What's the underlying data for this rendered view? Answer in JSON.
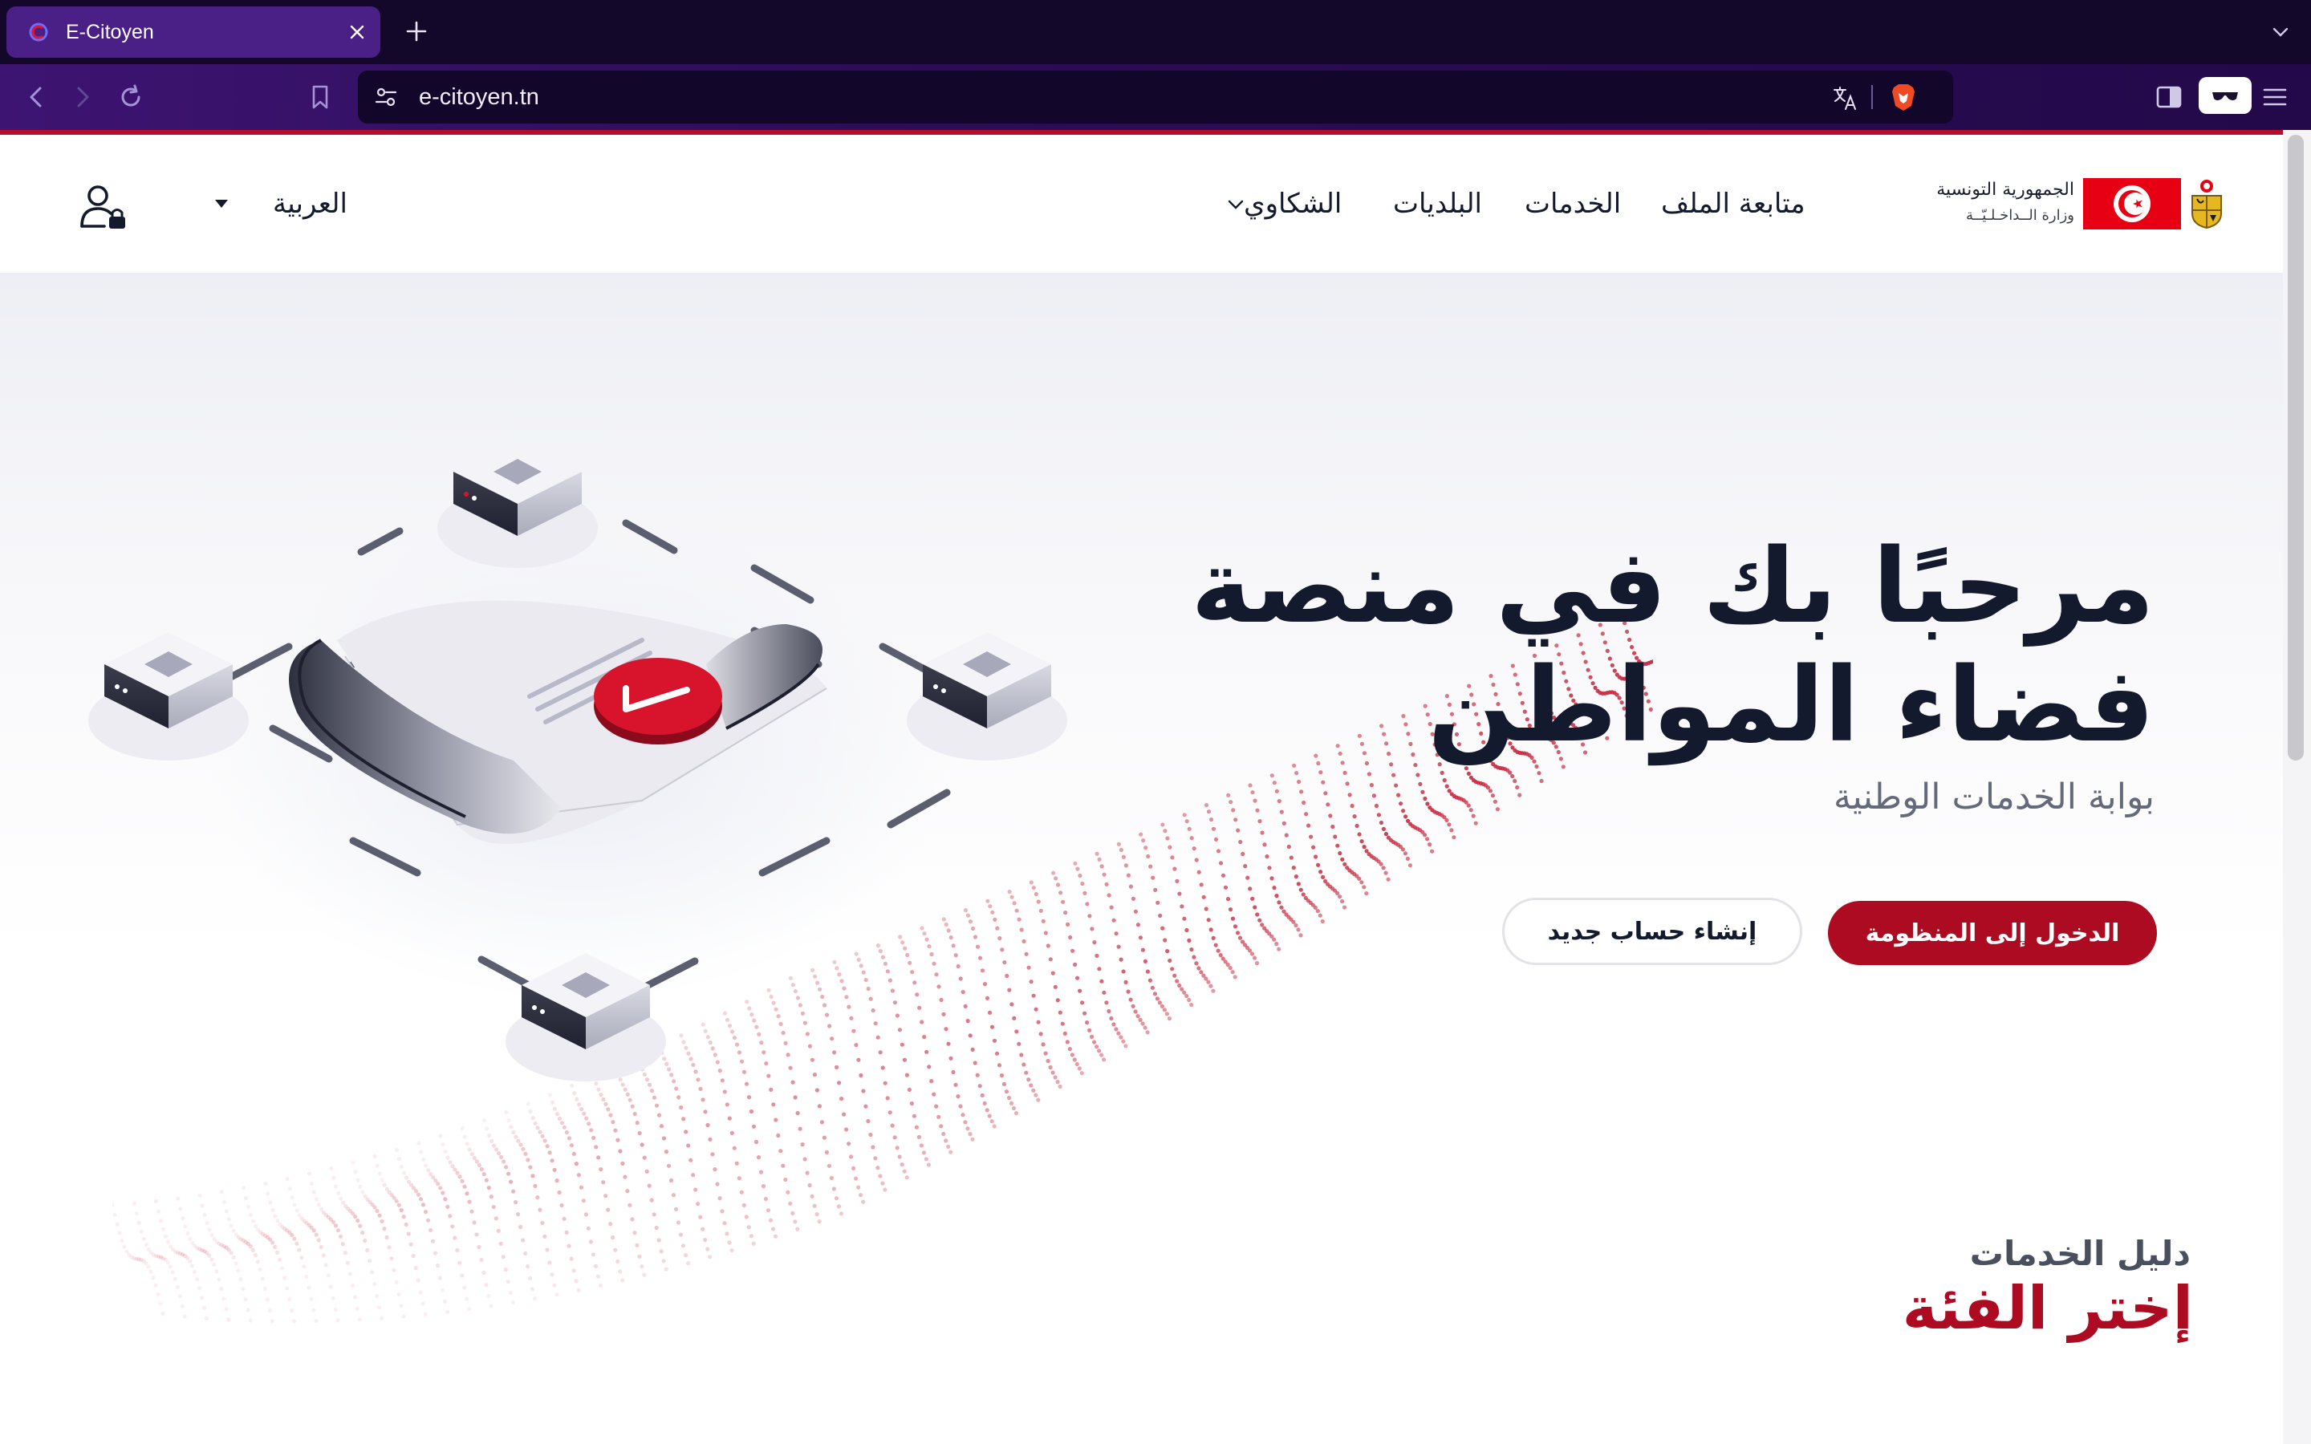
{
  "browser": {
    "tab": {
      "title": "E-Citoyen"
    },
    "address_bar": {
      "url": "e-citoyen.tn"
    },
    "accent_color": "#4a1f86"
  },
  "header": {
    "brand": {
      "line1": "الجمهورية التونسية",
      "line2": "وزارة الــداخـلـيّــة"
    },
    "nav": {
      "file_tracking": "متابعة الملف",
      "services": "الخدمات",
      "municipalities": "البلديات",
      "complaints": "الشكاوي"
    },
    "language": "العربية"
  },
  "hero": {
    "title": "مرحبًا بك في منصة فضاء المواطن",
    "subtitle": "بوابة الخدمات الوطنية",
    "login_button": "الدخول إلى المنظومة",
    "signup_button": "إنشاء حساب جديد"
  },
  "services_section": {
    "kicker": "دليل الخدمات",
    "title": "إختر الفئة"
  },
  "colors": {
    "brand_red": "#ac0b22",
    "text_dark": "#141a2e",
    "flag_red": "#e70013"
  }
}
